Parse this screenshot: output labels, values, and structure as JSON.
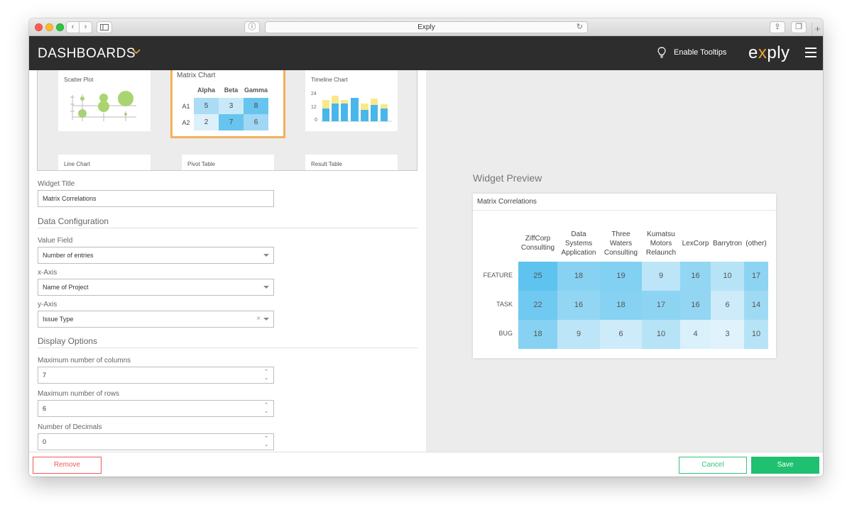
{
  "browser": {
    "url_title": "Exply",
    "back_label": "‹",
    "forward_label": "›",
    "reload_label": "↻",
    "info_label": "ⓘ",
    "share_label": "⇪",
    "tabs_label": "❐",
    "new_tab_label": "+"
  },
  "appbar": {
    "title": "DASHBOARDS",
    "chevron": "⌄",
    "tooltips_label": "Enable Tooltips",
    "logo_pre": "e",
    "logo_x": "x",
    "logo_post": "ply",
    "accent_color": "#f0a33a"
  },
  "gallery": {
    "scatter_title": "Scatter Plot",
    "matrix_title": "Matrix Chart",
    "timeline_title": "Timeline Chart",
    "line_title": "Line Chart",
    "pivot_title": "Pivot Table",
    "result_title": "Result Table",
    "matrix_columns": [
      "Alpha",
      "Beta",
      "Gamma"
    ],
    "matrix_rows": [
      {
        "label": "A1",
        "values": [
          "5",
          "3",
          "8"
        ]
      },
      {
        "label": "A2",
        "values": [
          "2",
          "7",
          "6"
        ]
      }
    ],
    "timeline_ticks": [
      "24",
      "12",
      "0"
    ]
  },
  "form": {
    "widget_title_label": "Widget Title",
    "widget_title_value": "Matrix Correlations",
    "data_config_header": "Data Configuration",
    "value_field_label": "Value Field",
    "value_field_value": "Number of entries",
    "x_axis_label": "x-Axis",
    "x_axis_value": "Name of Project",
    "y_axis_label": "y-Axis",
    "y_axis_value": "Issue Type",
    "y_axis_clear": "×",
    "display_options_header": "Display Options",
    "max_columns_label": "Maximum number of columns",
    "max_columns_value": "7",
    "max_rows_label": "Maximum number of rows",
    "max_rows_value": "6",
    "decimals_label": "Number of Decimals",
    "decimals_value": "0",
    "spin_up": "⌃",
    "spin_down": "⌄"
  },
  "preview": {
    "label": "Widget Preview",
    "card_title": "Matrix Correlations",
    "columns": [
      [
        "ZiffCorp",
        "Consulting"
      ],
      [
        "Data",
        "Systems",
        "Application"
      ],
      [
        "Three",
        "Waters",
        "Consulting"
      ],
      [
        "Kumatsu",
        "Motors",
        "Relaunch"
      ],
      [
        "LexCorp"
      ],
      [
        "Barrytron"
      ],
      [
        "(other)"
      ]
    ],
    "rows": [
      {
        "label": "FEATURE",
        "values": [
          "25",
          "18",
          "19",
          "9",
          "16",
          "10",
          "17"
        ]
      },
      {
        "label": "TASK",
        "values": [
          "22",
          "16",
          "18",
          "17",
          "16",
          "6",
          "14"
        ]
      },
      {
        "label": "BUG",
        "values": [
          "18",
          "9",
          "6",
          "10",
          "4",
          "3",
          "10"
        ]
      }
    ],
    "heat_low": "#f2f8fd",
    "heat_high": "#5ec3ee"
  },
  "footer": {
    "remove_label": "Remove",
    "cancel_label": "Cancel",
    "save_label": "Save",
    "danger_color": "#ee5a5a",
    "success_color": "#1fc070"
  }
}
